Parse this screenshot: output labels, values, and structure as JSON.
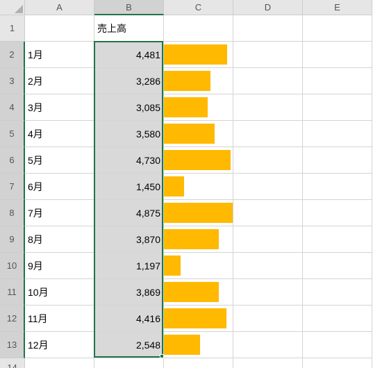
{
  "columns": [
    "A",
    "B",
    "C",
    "D",
    "E"
  ],
  "header_row": {
    "b": "売上高"
  },
  "rows": [
    {
      "n": 2,
      "month": "1月",
      "value": 4481,
      "value_fmt": "4,481"
    },
    {
      "n": 3,
      "month": "2月",
      "value": 3286,
      "value_fmt": "3,286"
    },
    {
      "n": 4,
      "month": "3月",
      "value": 3085,
      "value_fmt": "3,085"
    },
    {
      "n": 5,
      "month": "4月",
      "value": 3580,
      "value_fmt": "3,580"
    },
    {
      "n": 6,
      "month": "5月",
      "value": 4730,
      "value_fmt": "4,730"
    },
    {
      "n": 7,
      "month": "6月",
      "value": 1450,
      "value_fmt": "1,450"
    },
    {
      "n": 8,
      "month": "7月",
      "value": 4875,
      "value_fmt": "4,875"
    },
    {
      "n": 9,
      "month": "8月",
      "value": 3870,
      "value_fmt": "3,870"
    },
    {
      "n": 10,
      "month": "9月",
      "value": 1197,
      "value_fmt": "1,197"
    },
    {
      "n": 11,
      "month": "10月",
      "value": 3869,
      "value_fmt": "3,869"
    },
    {
      "n": 12,
      "month": "11月",
      "value": 4416,
      "value_fmt": "4,416"
    },
    {
      "n": 13,
      "month": "12月",
      "value": 2548,
      "value_fmt": "2,548"
    }
  ],
  "chart_data": {
    "type": "bar",
    "title": "売上高",
    "categories": [
      "1月",
      "2月",
      "3月",
      "4月",
      "5月",
      "6月",
      "7月",
      "8月",
      "9月",
      "10月",
      "11月",
      "12月"
    ],
    "values": [
      4481,
      3286,
      3085,
      3580,
      4730,
      1450,
      4875,
      3870,
      1197,
      3869,
      4416,
      2548
    ],
    "xlabel": "",
    "ylabel": "",
    "ylim": [
      0,
      5000
    ],
    "bar_color": "#ffb900"
  },
  "selection": {
    "col": "B",
    "row_start": 2,
    "row_end": 13
  },
  "row_labels": {
    "r1": "1",
    "r14": "14"
  }
}
